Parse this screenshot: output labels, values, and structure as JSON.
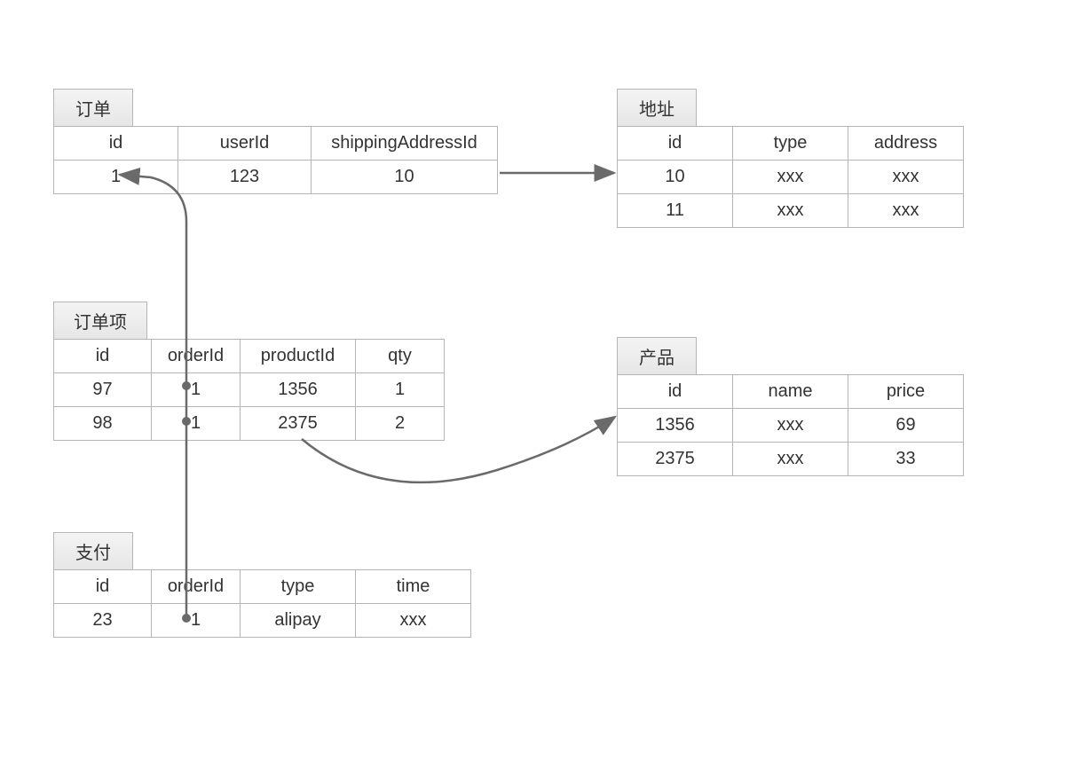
{
  "entities": {
    "order": {
      "title": "订单",
      "headers": [
        "id",
        "userId",
        "shippingAddressId"
      ],
      "rows": [
        [
          "1",
          "123",
          "10"
        ]
      ]
    },
    "address": {
      "title": "地址",
      "headers": [
        "id",
        "type",
        "address"
      ],
      "rows": [
        [
          "10",
          "xxx",
          "xxx"
        ],
        [
          "11",
          "xxx",
          "xxx"
        ]
      ]
    },
    "orderItem": {
      "title": "订单项",
      "headers": [
        "id",
        "orderId",
        "productId",
        "qty"
      ],
      "rows": [
        [
          "97",
          "1",
          "1356",
          "1"
        ],
        [
          "98",
          "1",
          "2375",
          "2"
        ]
      ]
    },
    "product": {
      "title": "产品",
      "headers": [
        "id",
        "name",
        "price"
      ],
      "rows": [
        [
          "1356",
          "xxx",
          "69"
        ],
        [
          "2375",
          "xxx",
          "33"
        ]
      ]
    },
    "payment": {
      "title": "支付",
      "headers": [
        "id",
        "orderId",
        "type",
        "time"
      ],
      "rows": [
        [
          "23",
          "1",
          "alipay",
          "xxx"
        ]
      ]
    }
  }
}
